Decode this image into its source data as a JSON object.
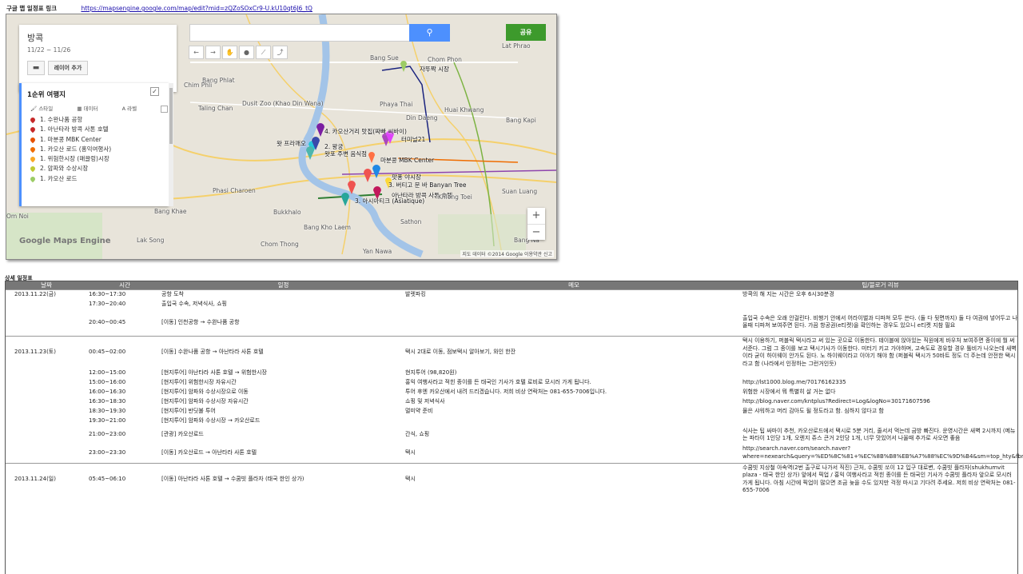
{
  "header": {
    "label": "구글 맵 일정표 링크",
    "link": "https://mapsengine.google.com/map/edit?mid=zQZoSOxCr9-U.kU10qt6J6_tQ"
  },
  "map": {
    "title": "방콕",
    "dates": "11/22 ~ 11/26",
    "add_layer": "레이어 추가",
    "search_icon": "search-icon",
    "share": "공유",
    "layer_title": "1순위 여행지",
    "tools": {
      "style": "스타일",
      "data": "데이터",
      "label": "라벨"
    },
    "items": [
      {
        "label": "1. 수완나품 공항",
        "color": "#c62828"
      },
      {
        "label": "1. 아난타라 방콕 사톤 호텔",
        "color": "#c62828"
      },
      {
        "label": "1. 마분콩 MBK Center",
        "color": "#e65100"
      },
      {
        "label": "1. 카오산 로드 (홍익여행사)",
        "color": "#ef6c00"
      },
      {
        "label": "1. 위험한시장 (매끌렁)시장",
        "color": "#f9a825"
      },
      {
        "label": "2. 암파와 수상시장",
        "color": "#c0ca33"
      },
      {
        "label": "1. 카오산 로드",
        "color": "#9ccc65"
      }
    ],
    "zoom_in": "+",
    "zoom_out": "−",
    "copyright": "지도 데이터 ©2014 Google   이용약관   신고",
    "logo": "Google Maps Engine",
    "place_labels": {
      "a": "자뚜짝 시장",
      "b": "4. 카오산거리 맛집(짜빠 씨바이)",
      "c": "왓 프라깨오",
      "d": "2. 왕궁",
      "e": "왓포 주변 음식점",
      "f": "터미널21",
      "g": "마분콩 MBK Center",
      "h": "팟퐁 야시장",
      "i": "3. 버티고 문 바 Banyan Tree",
      "j": "아난타라 방콕 사톤 호텔",
      "k": "3. 아시아티크 (Asiatique)",
      "l": "Bang Sue",
      "m": "Chom Phon",
      "n": "Lat Phrao",
      "o": "Bang Phlat",
      "p": "Dusit Zoo (Khao Din Wana)",
      "q": "Phaya Thai",
      "r": "Din Daeng",
      "s": "Huai Khwang",
      "t": "Chim Phli",
      "u": "Taling Chan",
      "v": "Bang Kapi",
      "w": "Suan Luang",
      "x": "Khlong Toei",
      "y": "Phasi Charoen",
      "z": "Bang Khae",
      "aa": "Bukkhalo",
      "ab": "Bang Kho Laem",
      "ac": "Chom Thong",
      "ad": "Lak Song",
      "ae": "Yan Nawa",
      "af": "Om Noi",
      "ag": "Sathon",
      "ah": "Bang Na"
    }
  },
  "detail_title": "상세 일정표",
  "table": {
    "headers": [
      "날짜",
      "시간",
      "일정",
      "메모",
      "팁/블로거 리뷰"
    ],
    "rows": [
      {
        "date": "2013.11.22(금)",
        "time": "16:30~17:30",
        "plan": "공항 도착",
        "memo": "발렛파킹",
        "tip": "방콕의 해 지는 시간은 오후 6시30분경",
        "sep": true
      },
      {
        "date": "",
        "time": "17:30~20:40",
        "plan": "출입국 수속, 저녁식사, 쇼핑",
        "memo": "",
        "tip": ""
      },
      {
        "date": "",
        "time": "20:40~00:45",
        "plan": "[이동] 인천공항 → 수완나품 공항",
        "memo": "",
        "tip": "출입국 수속은 오래 안걸린다. 비행기 안에서 어라이벌과 디파쳐 모두 쓴다. (둘 다 뒷면까지) 둘 다 여권에 넣어두고 나올때 디파쳐 보여주면 된다. 가끔 항공권(e티켓)을 확인하는 경우도 있으니 e티켓 지참 필요"
      },
      {
        "date": "2013.11.23(토)",
        "time": "00:45~02:00",
        "plan": "[이동] 수완나품 공항 → 아난타라 사톤 호텔",
        "memo": "택시 2대로 이동, 점보택시 알아보기, 와인 한잔",
        "tip": "택시 이용하기, 퍼블릭 택시라고 써 있는 곳으로 이동한다. 테이블에 앉아있는 직원에게 바우처 보여주면 종이에 뭘 써서준다. 그럼 그 종이를 보고 택시기사가 이동한다. 미터기 키고 가야하며, 고속도로 경유할 경우 톨비가 나오는데 새벽이라 굳이 하이웨이 안가도 된다. 노 하이웨이라고 이야기 해야 함 (퍼블릭 택시가 50바트 정도 더 주는데 안전한 택시라고 함 (나라에서 인정하는 그런거인듯)",
        "sep": true
      },
      {
        "date": "",
        "time": "12:00~15:00",
        "plan": "[현지투어] 아난타라 사톤 호텔 → 위험한시장",
        "memo": "현지투어 (98,820원)",
        "tip": ""
      },
      {
        "date": "",
        "time": "15:00~16:00",
        "plan": "[현지투어] 위험한시장 자유시간",
        "memo": "홍익 여행사라고 적힌 종이를 든 태국인 기사가 호텔 로비로 모시러 가게 됩니다.",
        "tip": "http://lst1000.blog.me/70176162335"
      },
      {
        "date": "",
        "time": "16:00~16:30",
        "plan": "[현지투어] 암파와 수상시장으로 이동",
        "memo": " 투어 후엔 카오산에서 내려 드리겠습니다. 저희 비상 연락처는 081-655-7006입니다.",
        "tip": "위험한 시장에서 뭐 특별히 살 거는 없다"
      },
      {
        "date": "",
        "time": "16:30~18:30",
        "plan": "[현지투어] 암파와 수상시장 자유시간",
        "memo": "쇼핑 및 저녁식사",
        "tip": "http://blog.naver.com/kntplus?Redirect=Log&logNo=30171607596"
      },
      {
        "date": "",
        "time": "18:30~19:30",
        "plan": "[현지투어] 반딧불 투어",
        "memo": "멀미약 준비",
        "tip": "물은 샤워하고 머리 감아도 될 정도라고 함. 심하지 않다고 함"
      },
      {
        "date": "",
        "time": "19:30~21:00",
        "plan": "[현지투어] 암파와 수상시장 → 카오산로드",
        "memo": "",
        "tip": ""
      },
      {
        "date": "",
        "time": "21:00~23:00",
        "plan": "[관광] 카오산로드",
        "memo": "간식, 쇼핑",
        "tip": "식사는 팁 싸마이 추천, 카오산로드에서 택시로 5분 거리, 줄서서 먹는데 금방 빠진다. 운영시간은 새벽 2시까지 (메뉴는 파타이 1인당 1개, 오렌지 쥬스 큰거 2인당 1개, 너무 맛있어서 나올때 추가로 사오면 좋음"
      },
      {
        "date": "",
        "time": "23:00~23:30",
        "plan": "[이동] 카오산로드 → 아난타라 사톤 호텔",
        "memo": "택시",
        "tip": "http://search.naver.com/search.naver?where=nexearch&query=%ED%8C%81+%EC%8B%B8%EB%A7%88%EC%9D%B4&sm=top_hty&fbm=1&ie=utf8"
      },
      {
        "date": "2013.11.24(일)",
        "time": "05:45~06:10",
        "plan": "[이동] 아난타라 사톤 호텔 → 수쿰빗 플라자 (태국 한인 상가)",
        "memo": "택시",
        "tip": "수쿰빗 지상철 아속역(2번 출구로 나가서 직진) 근처, 수쿰빗 쏘이 12 입구 대로변, 수쿰빗 플라자(shukhumvit plaza - 태국 한인 상가) 앞에서 픽업 / 홍익 여행사라고 적힌 종이를 든 태국인 기사가 수쿰빗 플라자 앞으로 모시러 가게 됩니다. 아침 시간에 픽업이 많으면 조금 늦을 수도 있지만 걱정 마시고 기다려 주세요. 저희 비상 연락처는 081-655-7006",
        "sep": true
      }
    ]
  }
}
